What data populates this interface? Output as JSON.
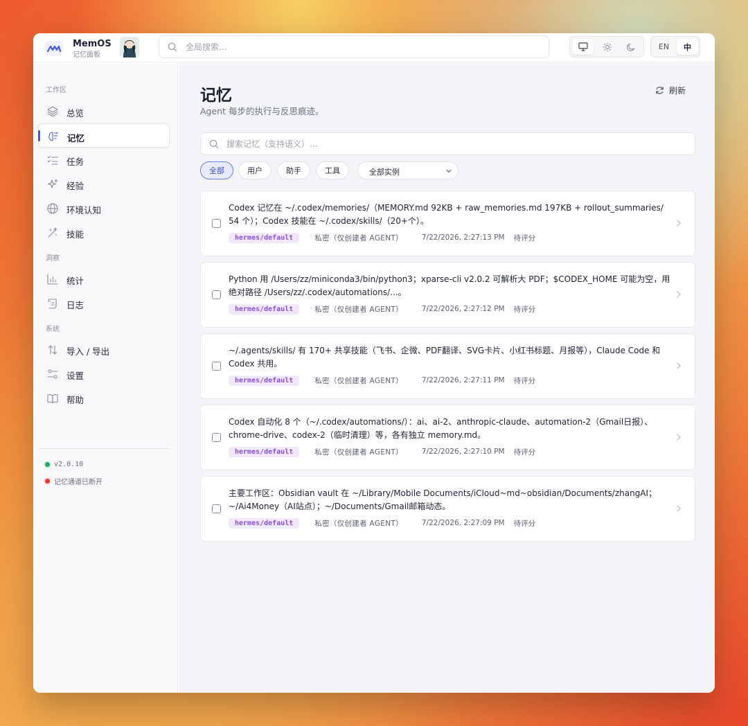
{
  "brand": {
    "name": "MemOS",
    "subtitle": "记忆面板"
  },
  "header": {
    "search_placeholder": "全局搜索...",
    "theme_buttons": [
      "monitor-icon",
      "sun-icon",
      "moon-icon"
    ],
    "lang": {
      "en": "EN",
      "zh": "中",
      "active": "zh"
    }
  },
  "sidebar": {
    "sections": {
      "workspace": "工作区",
      "insights": "洞察",
      "system": "系统"
    },
    "items": {
      "overview": "总览",
      "memories": "记忆",
      "tasks": "任务",
      "experience": "经验",
      "env": "环境认知",
      "skills": "技能",
      "stats": "统计",
      "logs": "日志",
      "import_export": "导入 / 导出",
      "settings": "设置",
      "help": "帮助"
    },
    "version": "v2.0.10",
    "channel_status": "记忆通道已断开",
    "colors": {
      "version_dot": "#22a565",
      "status_dot": "#e53935",
      "accent": "#4b5bd6"
    }
  },
  "main": {
    "title": "记忆",
    "subtitle": "Agent 每步的执行与反思痕迹。",
    "refresh_label": "刷新",
    "search_placeholder": "搜索记忆（支持语义）...",
    "filters": [
      "全部",
      "用户",
      "助手",
      "工具"
    ],
    "active_filter": "全部",
    "instance_select": "全部实例",
    "cards": [
      {
        "text": "Codex 记忆在 ~/.codex/memories/（MEMORY.md 92KB + raw_memories.md 197KB + rollout_summaries/ 54 个）；Codex 技能在 ~/.codex/skills/（20+个）。",
        "tag": "hermes/default",
        "visibility": "私密（仅创建者 AGENT）",
        "time": "7/22/2026, 2:27:13 PM",
        "status": "待评分"
      },
      {
        "text": "Python 用 /Users/zz/miniconda3/bin/python3；xparse-cli v2.0.2 可解析大 PDF；$CODEX_HOME 可能为空，用绝对路径 /Users/zz/.codex/automations/...。",
        "tag": "hermes/default",
        "visibility": "私密（仅创建者 AGENT）",
        "time": "7/22/2026, 2:27:12 PM",
        "status": "待评分"
      },
      {
        "text": "~/.agents/skills/ 有 170+ 共享技能（飞书、企微、PDF翻译、SVG卡片、小红书标题、月报等），Claude Code 和 Codex 共用。",
        "tag": "hermes/default",
        "visibility": "私密（仅创建者 AGENT）",
        "time": "7/22/2026, 2:27:11 PM",
        "status": "待评分"
      },
      {
        "text": "Codex 自动化 8 个（~/.codex/automations/）：ai、ai-2、anthropic-claude、automation-2（Gmail日报）、chrome-drive、codex-2（临时清理）等，各有独立 memory.md。",
        "tag": "hermes/default",
        "visibility": "私密（仅创建者 AGENT）",
        "time": "7/22/2026, 2:27:10 PM",
        "status": "待评分"
      },
      {
        "text": "主要工作区：Obsidian vault 在 ~/Library/Mobile Documents/iCloud~md~obsidian/Documents/zhangAI；~/Ai4Money（AI站点）；~/Documents/Gmail邮箱动态。",
        "tag": "hermes/default",
        "visibility": "私密（仅创建者 AGENT）",
        "time": "7/22/2026, 2:27:09 PM",
        "status": "待评分"
      }
    ]
  }
}
